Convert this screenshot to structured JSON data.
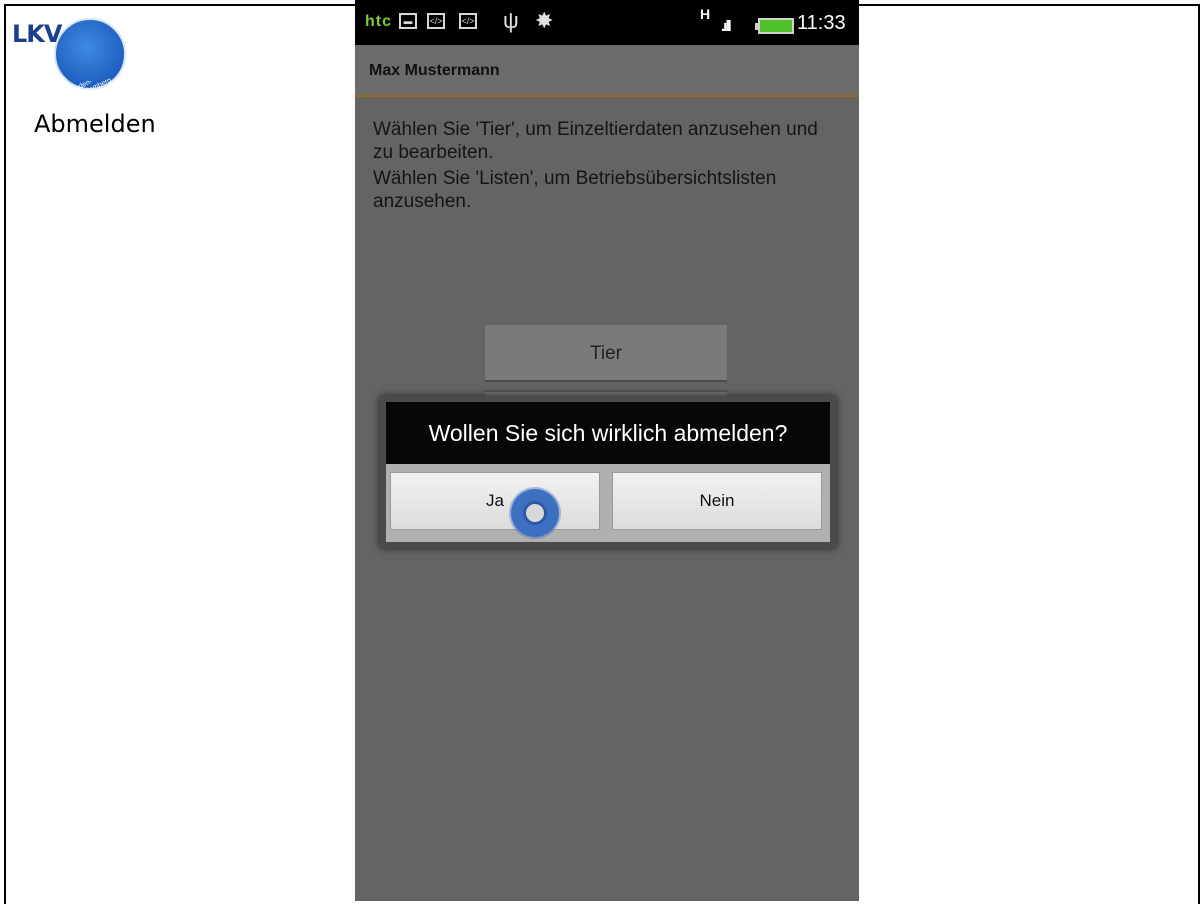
{
  "left_panel": {
    "logo_text": "LKV",
    "logo_ring_text": "Baden-Württemberg",
    "label": "Abmelden"
  },
  "status_bar": {
    "carrier": "htc",
    "network": "H",
    "time": "11:33",
    "icons": [
      "image-icon",
      "code-icon",
      "code-icon",
      "usb-icon",
      "android-debug-icon",
      "signal-icon",
      "battery-icon"
    ]
  },
  "titlebar": {
    "user": "Max Mustermann"
  },
  "info": {
    "line1": "Wählen Sie 'Tier', um Einzeltierdaten anzusehen und zu bearbeiten.",
    "line2": "Wählen Sie 'Listen', um Betriebsübersichtslisten anzusehen."
  },
  "buttons": {
    "tier": "Tier"
  },
  "dialog": {
    "message": "Wollen Sie sich wirklich abmelden?",
    "yes": "Ja",
    "no": "Nein"
  },
  "colors": {
    "accent_line": "#9a6a21",
    "touch": "#3e70c2",
    "htc": "#7ccc3c",
    "battery": "#51c12a"
  }
}
